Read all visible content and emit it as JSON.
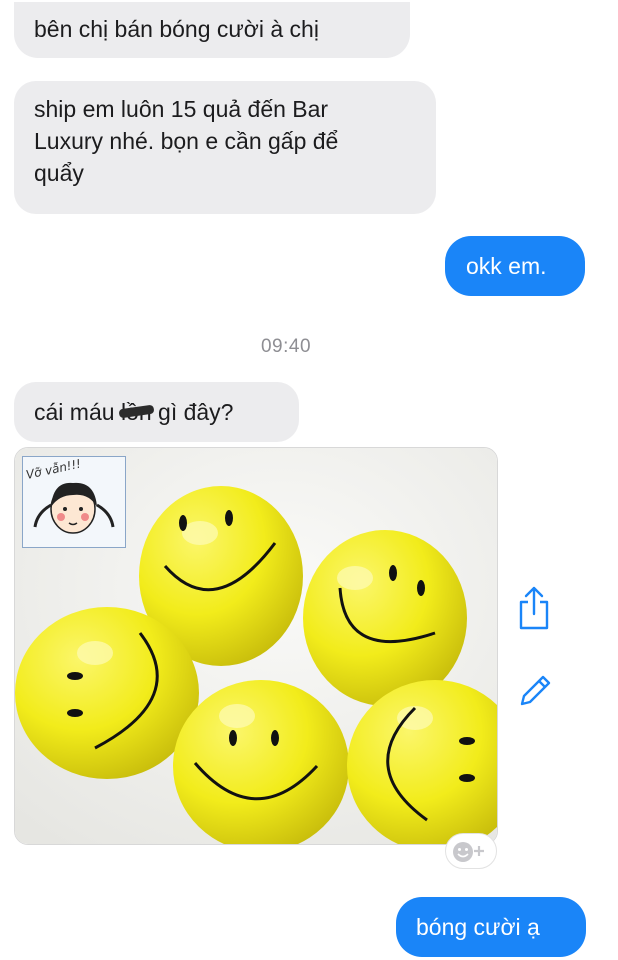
{
  "messages": [
    {
      "id": "b1",
      "direction": "incoming",
      "text": "bên chị bán bóng cười à chị"
    },
    {
      "id": "b2",
      "direction": "incoming",
      "lines": [
        "ship em luôn 15 quả đến Bar",
        "Luxury nhé. bọn e cần gấp để",
        "quẩy"
      ]
    },
    {
      "id": "b3",
      "direction": "outgoing",
      "text": "okk em."
    },
    {
      "id": "b4",
      "direction": "incoming",
      "before": "cái máu ",
      "censored": "lồn",
      "after": " gì đây?"
    },
    {
      "id": "b5",
      "direction": "outgoing",
      "text": "bóng cười ạ"
    }
  ],
  "timestamp": "09:40",
  "photo": {
    "watermark_text": "Vỡ vẫn!!!",
    "balloon_color": "#f2ec1b",
    "balloon_count": 5
  },
  "icons": {
    "share": "share-icon",
    "edit": "pencil-icon",
    "react": "add-reaction-icon"
  },
  "colors": {
    "incoming": "#ececee",
    "outgoing": "#1a85f8",
    "timestamp": "#8e8e93",
    "icon": "#1a85f8"
  }
}
